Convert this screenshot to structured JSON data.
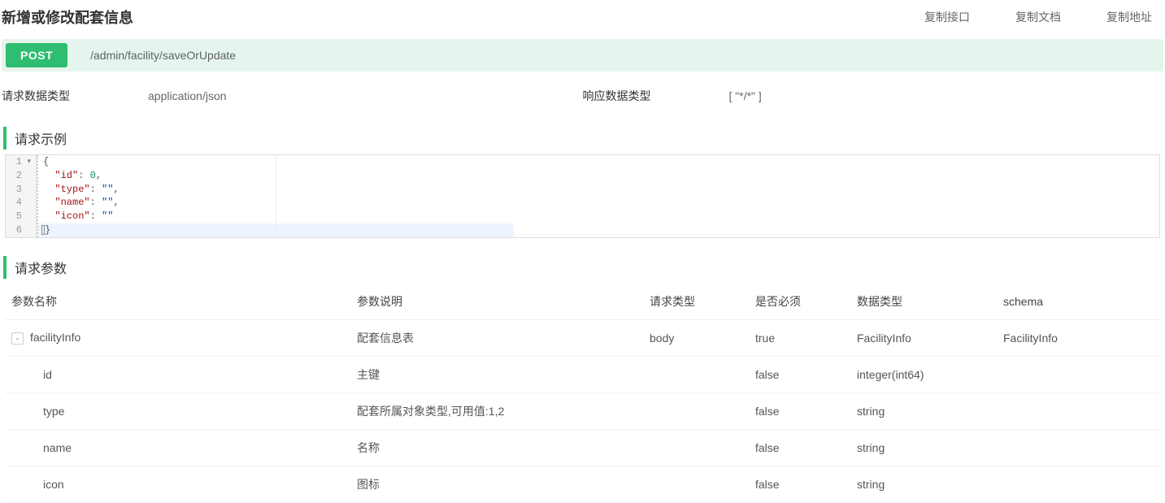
{
  "header": {
    "title": "新增或修改配套信息",
    "actions": {
      "copy_api": "复制接口",
      "copy_doc": "复制文档",
      "copy_url": "复制地址"
    }
  },
  "endpoint": {
    "method": "POST",
    "path": "/admin/facility/saveOrUpdate"
  },
  "meta": {
    "request_type_label": "请求数据类型",
    "request_type_value": "application/json",
    "response_type_label": "响应数据类型",
    "response_type_value": "[ \"*/*\" ]"
  },
  "sections": {
    "example_title": "请求示例",
    "params_title": "请求参数"
  },
  "code_lines": {
    "l1": "{",
    "l6": "}"
  },
  "code_kv": {
    "id_key": "\"id\"",
    "id_val": "0",
    "type_key": "\"type\"",
    "type_val": "\"\"",
    "name_key": "\"name\"",
    "name_val": "\"\"",
    "icon_key": "\"icon\"",
    "icon_val": "\"\""
  },
  "params": {
    "head": {
      "name": "参数名称",
      "desc": "参数说明",
      "reqtype": "请求类型",
      "required": "是否必须",
      "dtype": "数据类型",
      "schema": "schema"
    },
    "rows": [
      {
        "indent": 0,
        "expand": true,
        "name": "facilityInfo",
        "desc": "配套信息表",
        "reqtype": "body",
        "reqtype_color": "blue",
        "required": "true",
        "required_color": "red",
        "dtype": "FacilityInfo",
        "schema": "FacilityInfo"
      },
      {
        "indent": 1,
        "expand": false,
        "name": "id",
        "desc": "主键",
        "reqtype": "",
        "required": "false",
        "dtype": "integer(int64)",
        "schema": ""
      },
      {
        "indent": 1,
        "expand": false,
        "name": "type",
        "desc": "配套所属对象类型,可用值:1,2",
        "reqtype": "",
        "required": "false",
        "dtype": "string",
        "schema": ""
      },
      {
        "indent": 1,
        "expand": false,
        "name": "name",
        "desc": "名称",
        "reqtype": "",
        "required": "false",
        "dtype": "string",
        "schema": ""
      },
      {
        "indent": 1,
        "expand": false,
        "name": "icon",
        "desc": "图标",
        "reqtype": "",
        "required": "false",
        "dtype": "string",
        "schema": ""
      }
    ]
  }
}
